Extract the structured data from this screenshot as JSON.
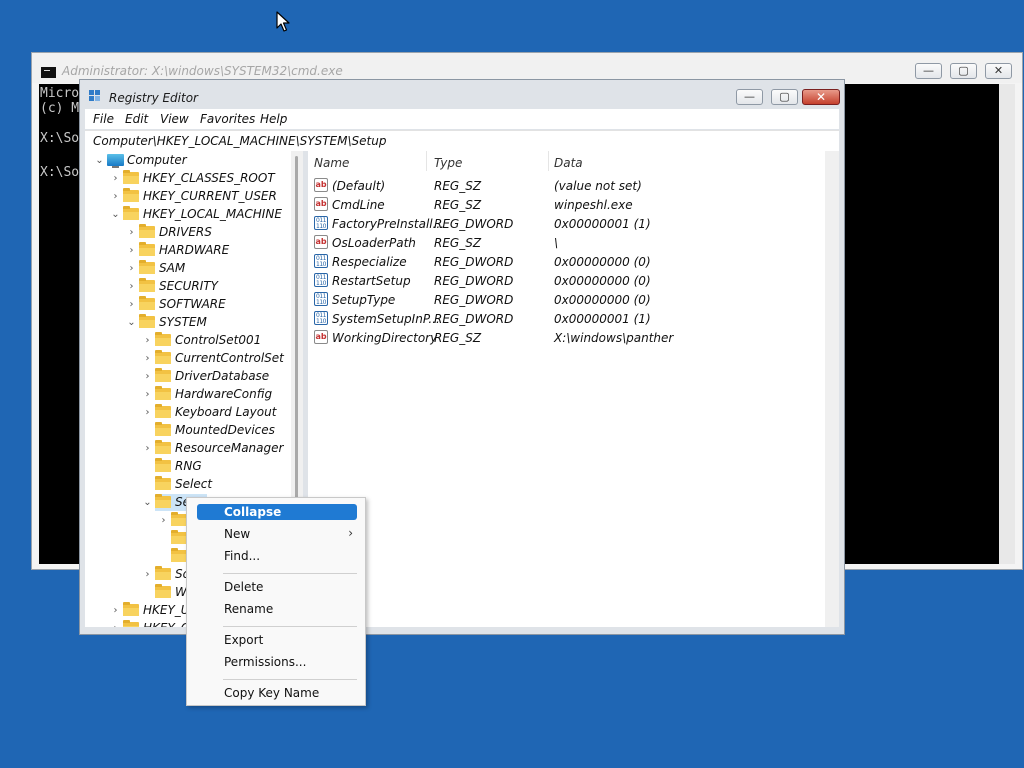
{
  "cmd": {
    "title": "Administrator: X:\\windows\\SYSTEM32\\cmd.exe",
    "lines": [
      "Micro",
      "(c) M",
      "",
      "X:\\So",
      "",
      "X:\\So"
    ]
  },
  "regedit": {
    "title": "Registry Editor",
    "menu": [
      "File",
      "Edit",
      "View",
      "Favorites",
      "Help"
    ],
    "address": "Computer\\HKEY_LOCAL_MACHINE\\SYSTEM\\Setup",
    "tree": [
      {
        "label": "Computer",
        "level": 0,
        "chev": "down",
        "icon": "computer-icon"
      },
      {
        "label": "HKEY_CLASSES_ROOT",
        "level": 1,
        "chev": "right",
        "icon": "folder-icon"
      },
      {
        "label": "HKEY_CURRENT_USER",
        "level": 1,
        "chev": "right",
        "icon": "folder-icon"
      },
      {
        "label": "HKEY_LOCAL_MACHINE",
        "level": 1,
        "chev": "down",
        "icon": "folder-icon"
      },
      {
        "label": "DRIVERS",
        "level": 2,
        "chev": "right",
        "icon": "folder-icon"
      },
      {
        "label": "HARDWARE",
        "level": 2,
        "chev": "right",
        "icon": "folder-icon"
      },
      {
        "label": "SAM",
        "level": 2,
        "chev": "right",
        "icon": "folder-icon"
      },
      {
        "label": "SECURITY",
        "level": 2,
        "chev": "right",
        "icon": "folder-icon"
      },
      {
        "label": "SOFTWARE",
        "level": 2,
        "chev": "right",
        "icon": "folder-icon"
      },
      {
        "label": "SYSTEM",
        "level": 2,
        "chev": "down",
        "icon": "folder-icon"
      },
      {
        "label": "ControlSet001",
        "level": 3,
        "chev": "right",
        "icon": "folder-icon"
      },
      {
        "label": "CurrentControlSet",
        "level": 3,
        "chev": "right",
        "icon": "folder-icon"
      },
      {
        "label": "DriverDatabase",
        "level": 3,
        "chev": "right",
        "icon": "folder-icon"
      },
      {
        "label": "HardwareConfig",
        "level": 3,
        "chev": "right",
        "icon": "folder-icon"
      },
      {
        "label": "Keyboard Layout",
        "level": 3,
        "chev": "right",
        "icon": "folder-icon"
      },
      {
        "label": "MountedDevices",
        "level": 3,
        "chev": "",
        "icon": "folder-icon"
      },
      {
        "label": "ResourceManager",
        "level": 3,
        "chev": "right",
        "icon": "folder-icon"
      },
      {
        "label": "RNG",
        "level": 3,
        "chev": "",
        "icon": "folder-icon"
      },
      {
        "label": "Select",
        "level": 3,
        "chev": "",
        "icon": "folder-icon"
      },
      {
        "label": "Se",
        "level": 3,
        "chev": "down",
        "icon": "folder-icon",
        "selected": true
      },
      {
        "label": "",
        "level": 4,
        "chev": "right",
        "icon": "folder-icon"
      },
      {
        "label": "",
        "level": 4,
        "chev": "",
        "icon": "folder-icon"
      },
      {
        "label": "",
        "level": 4,
        "chev": "",
        "icon": "folder-icon"
      },
      {
        "label": "Sc",
        "level": 3,
        "chev": "right",
        "icon": "folder-icon"
      },
      {
        "label": "W",
        "level": 3,
        "chev": "",
        "icon": "folder-icon"
      },
      {
        "label": "HKEY_U",
        "level": 1,
        "chev": "right",
        "icon": "folder-icon"
      },
      {
        "label": "HKEY_C",
        "level": 1,
        "chev": "right",
        "icon": "folder-icon"
      }
    ],
    "columns": [
      "Name",
      "Type",
      "Data"
    ],
    "values": [
      {
        "name": "(Default)",
        "type": "REG_SZ",
        "data": "(value not set)",
        "icon": "string-value-icon"
      },
      {
        "name": "CmdLine",
        "type": "REG_SZ",
        "data": "winpeshl.exe",
        "icon": "string-value-icon"
      },
      {
        "name": "FactoryPreInstall...",
        "type": "REG_DWORD",
        "data": "0x00000001 (1)",
        "icon": "binary-value-icon"
      },
      {
        "name": "OsLoaderPath",
        "type": "REG_SZ",
        "data": "\\",
        "icon": "string-value-icon"
      },
      {
        "name": "Respecialize",
        "type": "REG_DWORD",
        "data": "0x00000000 (0)",
        "icon": "binary-value-icon"
      },
      {
        "name": "RestartSetup",
        "type": "REG_DWORD",
        "data": "0x00000000 (0)",
        "icon": "binary-value-icon"
      },
      {
        "name": "SetupType",
        "type": "REG_DWORD",
        "data": "0x00000000 (0)",
        "icon": "binary-value-icon"
      },
      {
        "name": "SystemSetupInP...",
        "type": "REG_DWORD",
        "data": "0x00000001 (1)",
        "icon": "binary-value-icon"
      },
      {
        "name": "WorkingDirectory",
        "type": "REG_SZ",
        "data": "X:\\windows\\panther",
        "icon": "string-value-icon"
      }
    ]
  },
  "context_menu": {
    "items": [
      {
        "label": "Collapse",
        "highlighted": true
      },
      {
        "label": "New",
        "submenu": true
      },
      {
        "label": "Find..."
      },
      {
        "separator": true
      },
      {
        "label": "Delete"
      },
      {
        "label": "Rename"
      },
      {
        "separator": true
      },
      {
        "label": "Export"
      },
      {
        "label": "Permissions..."
      },
      {
        "separator": true
      },
      {
        "label": "Copy Key Name"
      }
    ],
    "submenu_arrow": "›"
  },
  "icons": {
    "string_glyph": "ab",
    "binary_glyph": "011 110",
    "min": "—",
    "max": "▢",
    "close": "✕",
    "chev_right": "›",
    "chev_down": "⌄"
  },
  "colors": {
    "desktop": "#1f66b4",
    "highlight": "#1f7ad3",
    "selection": "#cce4f7"
  }
}
